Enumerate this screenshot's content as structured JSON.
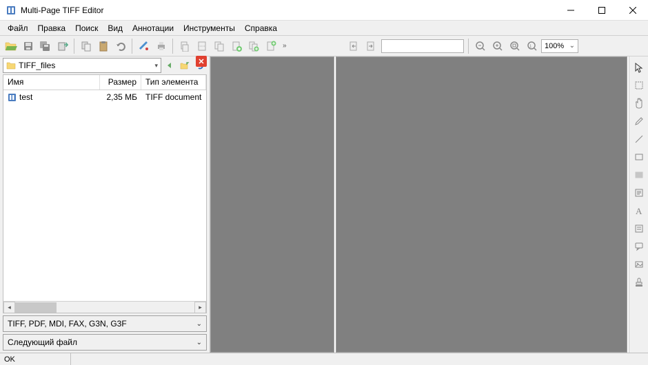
{
  "window": {
    "title": "Multi-Page TIFF Editor"
  },
  "menu": {
    "file": "Файл",
    "edit": "Правка",
    "search": "Поиск",
    "view": "Вид",
    "annotations": "Аннотации",
    "tools": "Инструменты",
    "help": "Справка"
  },
  "path": {
    "folder": "TIFF_files"
  },
  "list": {
    "headers": {
      "name": "Имя",
      "size": "Размер",
      "type": "Тип элемента"
    },
    "rows": [
      {
        "name": "test",
        "size": "2,35 МБ",
        "type": "TIFF document"
      }
    ]
  },
  "filter": {
    "value": "TIFF, PDF, MDI, FAX, G3N, G3F"
  },
  "nextfile": {
    "label": "Следующий файл"
  },
  "zoom": {
    "value": "100%"
  },
  "status": {
    "text": "OK"
  }
}
